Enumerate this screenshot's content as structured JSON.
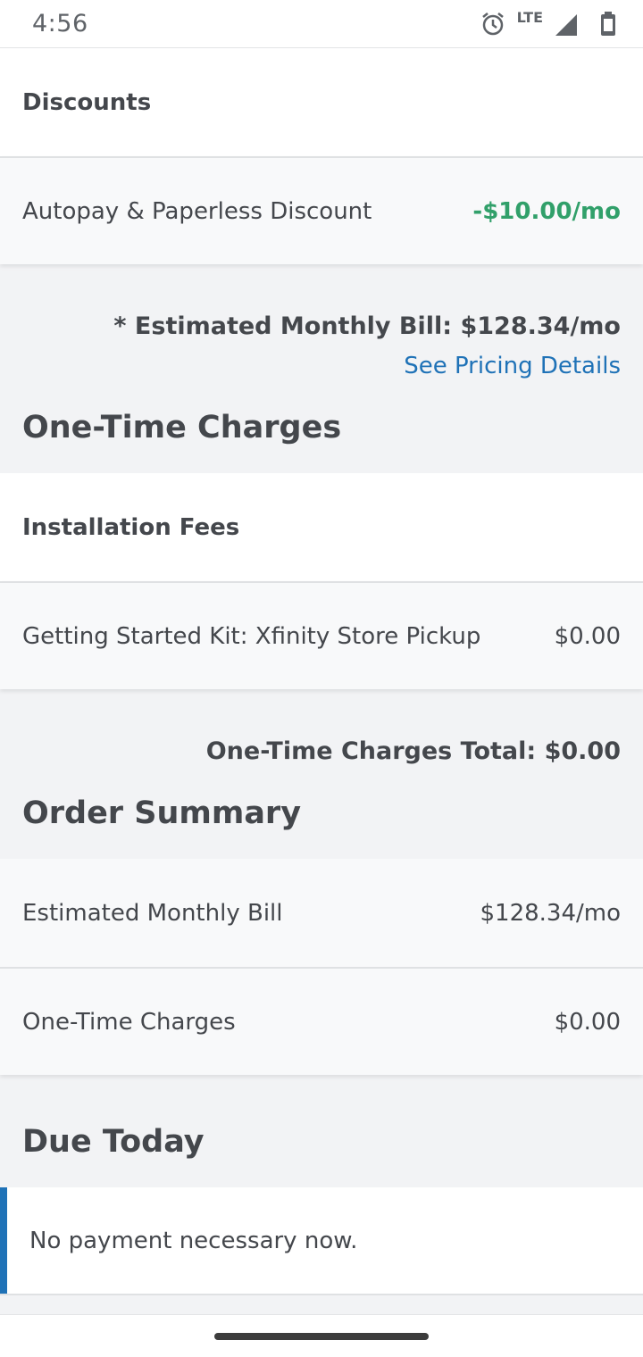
{
  "status_bar": {
    "time": "4:56",
    "network": "LTE",
    "icons": [
      "alarm-icon",
      "signal-icon",
      "battery-icon"
    ]
  },
  "discounts": {
    "header": "Discounts",
    "items": [
      {
        "label": "Autopay & Paperless Discount",
        "value": "-$10.00/mo"
      }
    ]
  },
  "monthly_estimate": {
    "text": "* Estimated Monthly Bill: $128.34/mo",
    "link": "See Pricing Details"
  },
  "one_time_charges": {
    "title": "One-Time Charges",
    "section_header": "Installation Fees",
    "items": [
      {
        "label": "Getting Started Kit: Xfinity Store Pickup",
        "value": "$0.00"
      }
    ],
    "total": "One-Time Charges Total: $0.00"
  },
  "order_summary": {
    "title": "Order Summary",
    "rows": [
      {
        "label": "Estimated Monthly Bill",
        "value": "$128.34/mo"
      },
      {
        "label": "One-Time Charges",
        "value": "$0.00"
      }
    ]
  },
  "due_today": {
    "title": "Due Today",
    "message": "No payment necessary now."
  },
  "colors": {
    "accent": "#1f72b7",
    "discount_green": "#31a06a",
    "background": "#f2f3f5"
  }
}
